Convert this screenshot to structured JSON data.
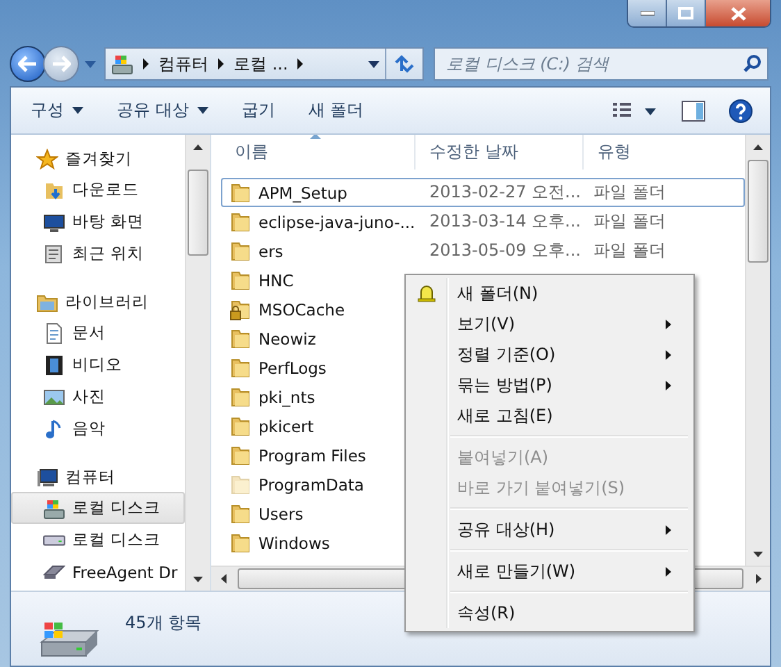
{
  "address": {
    "crumbs": [
      "컴퓨터",
      "로컬 ..."
    ]
  },
  "search": {
    "placeholder": "로컬 디스크 (C:) 검색"
  },
  "toolbar": {
    "buttons": [
      {
        "label": "구성",
        "dropdown": true
      },
      {
        "label": "공유 대상",
        "dropdown": true
      },
      {
        "label": "굽기",
        "dropdown": false
      },
      {
        "label": "새 폴더",
        "dropdown": false
      }
    ]
  },
  "sidebar": {
    "sections": [
      {
        "label": "즐겨찾기",
        "kind": "star",
        "items": [
          {
            "label": "다운로드",
            "kind": "download",
            "selected": false
          },
          {
            "label": "바탕 화면",
            "kind": "desktop",
            "selected": false
          },
          {
            "label": "최근 위치",
            "kind": "recent",
            "selected": false
          }
        ]
      },
      {
        "label": "라이브러리",
        "kind": "library",
        "items": [
          {
            "label": "문서",
            "kind": "document",
            "selected": false
          },
          {
            "label": "비디오",
            "kind": "video",
            "selected": false
          },
          {
            "label": "사진",
            "kind": "picture",
            "selected": false
          },
          {
            "label": "음악",
            "kind": "music",
            "selected": false
          }
        ]
      },
      {
        "label": "컴퓨터",
        "kind": "computer",
        "items": [
          {
            "label": "로컬 디스크",
            "kind": "system-disk",
            "selected": true
          },
          {
            "label": "로컬 디스크",
            "kind": "disk",
            "selected": false
          },
          {
            "label": "FreeAgent Dr",
            "kind": "external",
            "selected": false
          }
        ]
      }
    ]
  },
  "table": {
    "columns": [
      "이름",
      "수정한 날짜",
      "유형"
    ],
    "rows": [
      {
        "name": "APM_Setup",
        "date": "2013-02-27 오전...",
        "type": "파일 폴더",
        "kind": "folder",
        "selected": true
      },
      {
        "name": "eclipse-java-juno-...",
        "date": "2013-03-14 오후...",
        "type": "파일 폴더",
        "kind": "folder",
        "selected": false
      },
      {
        "name": "ers",
        "date": "2013-05-09 오후...",
        "type": "파일 폴더",
        "kind": "folder",
        "selected": false
      },
      {
        "name": "HNC",
        "kind": "folder",
        "selected": false
      },
      {
        "name": "MSOCache",
        "kind": "locked",
        "selected": false
      },
      {
        "name": "Neowiz",
        "kind": "folder",
        "selected": false
      },
      {
        "name": "PerfLogs",
        "kind": "folder",
        "selected": false
      },
      {
        "name": "pki_nts",
        "kind": "folder",
        "selected": false
      },
      {
        "name": "pkicert",
        "kind": "folder",
        "selected": false
      },
      {
        "name": "Program Files",
        "kind": "folder",
        "selected": false
      },
      {
        "name": "ProgramData",
        "kind": "hidden",
        "selected": false
      },
      {
        "name": "Users",
        "kind": "folder",
        "selected": false
      },
      {
        "name": "Windows",
        "kind": "folder",
        "selected": false
      }
    ]
  },
  "status_bar": {
    "text": "45개 항목"
  },
  "context_menu": {
    "groups": [
      [
        {
          "label": "새 폴더(N)",
          "icon": true,
          "submenu": false,
          "disabled": false
        },
        {
          "label": "보기(V)",
          "submenu": true,
          "disabled": false
        },
        {
          "label": "정렬 기준(O)",
          "submenu": true,
          "disabled": false
        },
        {
          "label": "묶는 방법(P)",
          "submenu": true,
          "disabled": false
        },
        {
          "label": "새로 고침(E)",
          "submenu": false,
          "disabled": false
        }
      ],
      [
        {
          "label": "붙여넣기(A)",
          "submenu": false,
          "disabled": true
        },
        {
          "label": "바로 가기 붙여넣기(S)",
          "submenu": false,
          "disabled": true
        }
      ],
      [
        {
          "label": "공유 대상(H)",
          "submenu": true,
          "disabled": false
        }
      ],
      [
        {
          "label": "새로 만들기(W)",
          "submenu": true,
          "disabled": false
        }
      ],
      [
        {
          "label": "속성(R)",
          "submenu": false,
          "disabled": false
        }
      ]
    ]
  }
}
